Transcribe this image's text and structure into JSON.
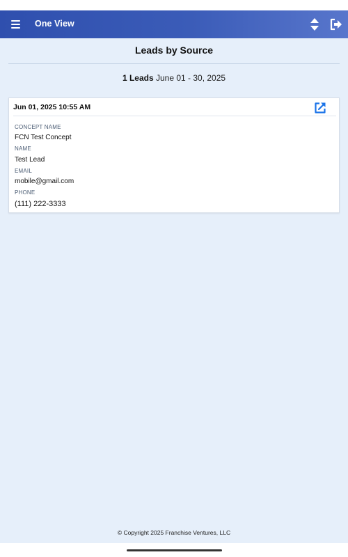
{
  "app": {
    "title": "One View"
  },
  "page": {
    "title": "Leads by Source",
    "summary_count": "1 Leads",
    "summary_range": "June 01 - 30, 2025"
  },
  "lead": {
    "datetime": "Jun 01, 2025 10:55 AM",
    "concept_label": "CONCEPT NAME",
    "concept_value": "FCN Test Concept",
    "name_label": "NAME",
    "name_value": "Test Lead",
    "email_label": "EMAIL",
    "email_value": "mobile@gmail.com",
    "phone_label": "PHONE",
    "phone_value": "(111) 222-3333"
  },
  "footer": {
    "copyright": "© Copyright 2025 Franchise Ventures, LLC"
  },
  "icons": {
    "menu": "hamburger-menu-icon",
    "sort": "sort-icon",
    "logout": "logout-icon",
    "open": "open-in-new-icon"
  },
  "colors": {
    "header_start": "#2f4fae",
    "header_end": "#5876cc",
    "background": "#e6effa",
    "accent": "#1a73e8"
  }
}
